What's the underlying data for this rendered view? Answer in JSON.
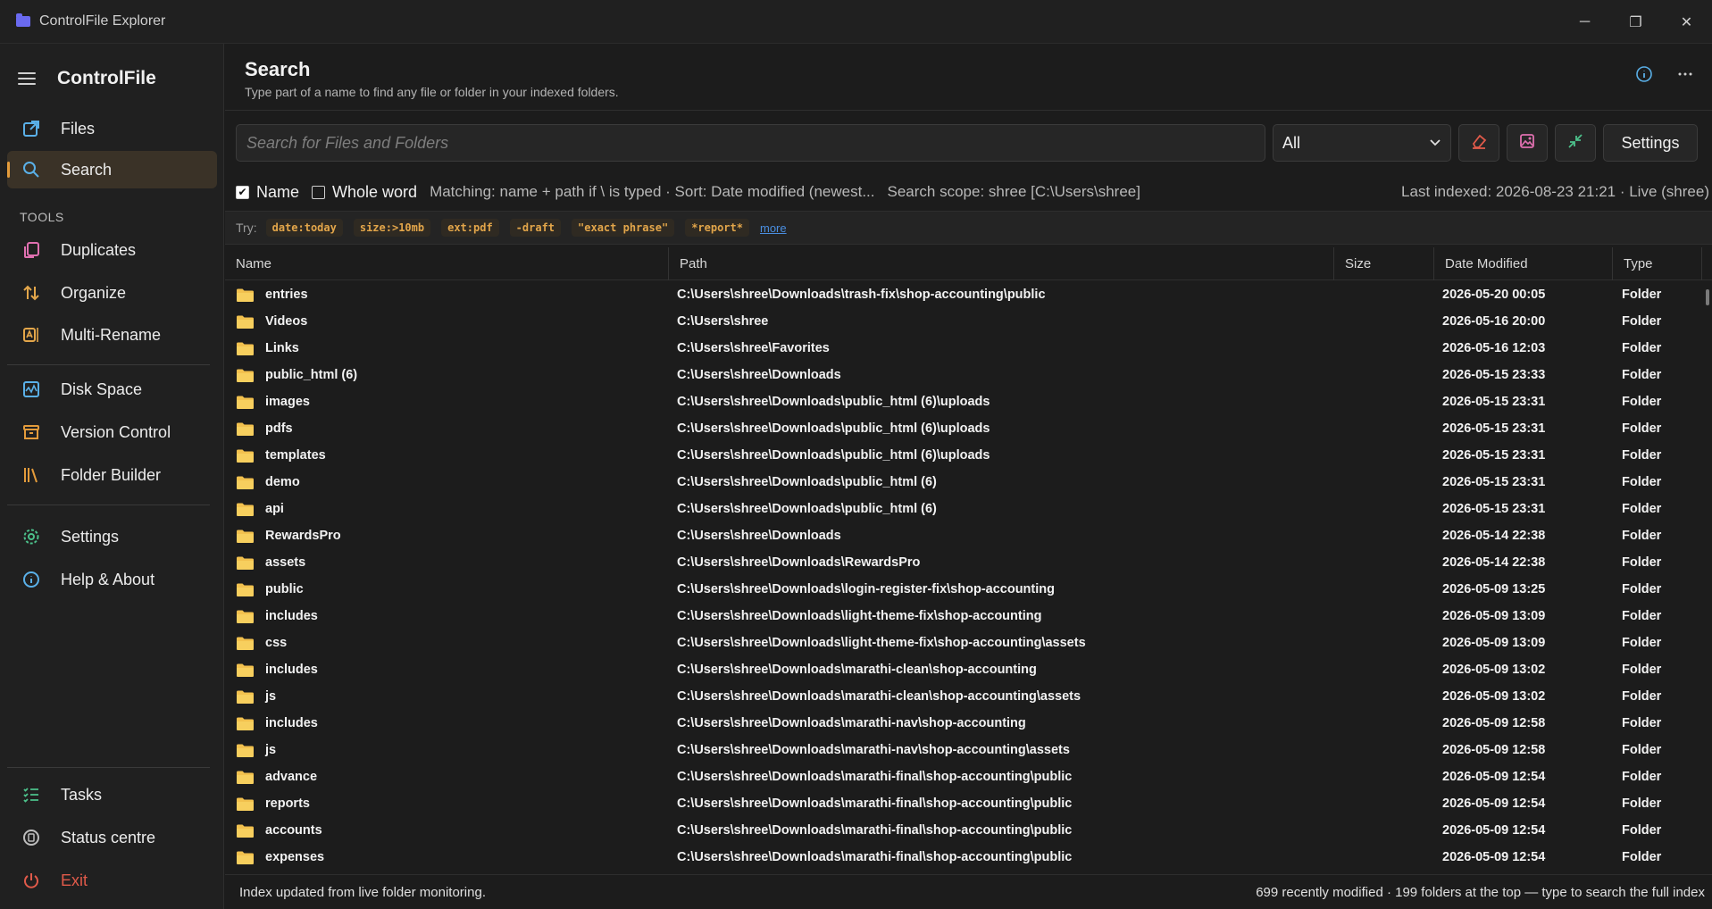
{
  "window": {
    "title": "ControlFile Explorer",
    "controls": {
      "minimize": "─",
      "restore": "❐",
      "close": "✕"
    }
  },
  "sidebar": {
    "brand": "ControlFile",
    "tools_label": "TOOLS",
    "items": [
      {
        "label": "Files",
        "icon": "external-link-icon",
        "color": "#5ab0e8"
      },
      {
        "label": "Search",
        "icon": "search-icon",
        "color": "#5ab0e8",
        "active": true
      },
      {
        "label": "Duplicates",
        "icon": "copy-icon",
        "color": "#e070b0"
      },
      {
        "label": "Organize",
        "icon": "sort-arrows-icon",
        "color": "#e3a64a"
      },
      {
        "label": "Multi-Rename",
        "icon": "rename-icon",
        "color": "#e3a64a"
      },
      {
        "label": "Disk Space",
        "icon": "activity-icon",
        "color": "#5ab0e8"
      },
      {
        "label": "Version Control",
        "icon": "archive-icon",
        "color": "#e39b3b"
      },
      {
        "label": "Folder Builder",
        "icon": "library-icon",
        "color": "#e39b3b"
      },
      {
        "label": "Settings",
        "icon": "gear-icon",
        "color": "#4cc08a"
      },
      {
        "label": "Help & About",
        "icon": "info-icon",
        "color": "#5ab0e8"
      },
      {
        "label": "Tasks",
        "icon": "checklist-icon",
        "color": "#4cc08a"
      },
      {
        "label": "Status centre",
        "icon": "status-icon",
        "color": "#bdbdbd"
      },
      {
        "label": "Exit",
        "icon": "power-icon",
        "color": "#e05a4a"
      }
    ]
  },
  "header": {
    "title": "Search",
    "subtitle": "Type part of a name to find any file or folder in your indexed folders."
  },
  "toolbar": {
    "search_placeholder": "Search for Files and Folders",
    "search_value": "",
    "filter_selected": "All",
    "settings_label": "Settings"
  },
  "options": {
    "name_label": "Name",
    "name_checked": true,
    "whole_word_label": "Whole word",
    "whole_word_checked": false,
    "matching_info": "Matching: name + path if \\ is typed · Sort: Date modified (newest...",
    "scope_info": "Search scope: shree  [C:\\Users\\shree]",
    "last_indexed": "Last indexed: 2026-08-23 21:21 · Live (shree)"
  },
  "try_row": {
    "label": "Try:",
    "chips": [
      "date:today",
      "size:>10mb",
      "ext:pdf",
      "-draft",
      "\"exact phrase\"",
      "*report*"
    ],
    "more": "more"
  },
  "table": {
    "columns": [
      "Name",
      "Path",
      "Size",
      "Date Modified",
      "Type"
    ],
    "rows": [
      {
        "name": "entries",
        "path": "C:\\Users\\shree\\Downloads\\trash-fix\\shop-accounting\\public",
        "size": "",
        "date": "2026-05-20 00:05",
        "type": "Folder"
      },
      {
        "name": "Videos",
        "path": "C:\\Users\\shree",
        "size": "",
        "date": "2026-05-16 20:00",
        "type": "Folder"
      },
      {
        "name": "Links",
        "path": "C:\\Users\\shree\\Favorites",
        "size": "",
        "date": "2026-05-16 12:03",
        "type": "Folder"
      },
      {
        "name": "public_html (6)",
        "path": "C:\\Users\\shree\\Downloads",
        "size": "",
        "date": "2026-05-15 23:33",
        "type": "Folder"
      },
      {
        "name": "images",
        "path": "C:\\Users\\shree\\Downloads\\public_html (6)\\uploads",
        "size": "",
        "date": "2026-05-15 23:31",
        "type": "Folder"
      },
      {
        "name": "pdfs",
        "path": "C:\\Users\\shree\\Downloads\\public_html (6)\\uploads",
        "size": "",
        "date": "2026-05-15 23:31",
        "type": "Folder"
      },
      {
        "name": "templates",
        "path": "C:\\Users\\shree\\Downloads\\public_html (6)\\uploads",
        "size": "",
        "date": "2026-05-15 23:31",
        "type": "Folder"
      },
      {
        "name": "demo",
        "path": "C:\\Users\\shree\\Downloads\\public_html (6)",
        "size": "",
        "date": "2026-05-15 23:31",
        "type": "Folder"
      },
      {
        "name": "api",
        "path": "C:\\Users\\shree\\Downloads\\public_html (6)",
        "size": "",
        "date": "2026-05-15 23:31",
        "type": "Folder"
      },
      {
        "name": "RewardsPro",
        "path": "C:\\Users\\shree\\Downloads",
        "size": "",
        "date": "2026-05-14 22:38",
        "type": "Folder"
      },
      {
        "name": "assets",
        "path": "C:\\Users\\shree\\Downloads\\RewardsPro",
        "size": "",
        "date": "2026-05-14 22:38",
        "type": "Folder"
      },
      {
        "name": "public",
        "path": "C:\\Users\\shree\\Downloads\\login-register-fix\\shop-accounting",
        "size": "",
        "date": "2026-05-09 13:25",
        "type": "Folder"
      },
      {
        "name": "includes",
        "path": "C:\\Users\\shree\\Downloads\\light-theme-fix\\shop-accounting",
        "size": "",
        "date": "2026-05-09 13:09",
        "type": "Folder"
      },
      {
        "name": "css",
        "path": "C:\\Users\\shree\\Downloads\\light-theme-fix\\shop-accounting\\assets",
        "size": "",
        "date": "2026-05-09 13:09",
        "type": "Folder"
      },
      {
        "name": "includes",
        "path": "C:\\Users\\shree\\Downloads\\marathi-clean\\shop-accounting",
        "size": "",
        "date": "2026-05-09 13:02",
        "type": "Folder"
      },
      {
        "name": "js",
        "path": "C:\\Users\\shree\\Downloads\\marathi-clean\\shop-accounting\\assets",
        "size": "",
        "date": "2026-05-09 13:02",
        "type": "Folder"
      },
      {
        "name": "includes",
        "path": "C:\\Users\\shree\\Downloads\\marathi-nav\\shop-accounting",
        "size": "",
        "date": "2026-05-09 12:58",
        "type": "Folder"
      },
      {
        "name": "js",
        "path": "C:\\Users\\shree\\Downloads\\marathi-nav\\shop-accounting\\assets",
        "size": "",
        "date": "2026-05-09 12:58",
        "type": "Folder"
      },
      {
        "name": "advance",
        "path": "C:\\Users\\shree\\Downloads\\marathi-final\\shop-accounting\\public",
        "size": "",
        "date": "2026-05-09 12:54",
        "type": "Folder"
      },
      {
        "name": "reports",
        "path": "C:\\Users\\shree\\Downloads\\marathi-final\\shop-accounting\\public",
        "size": "",
        "date": "2026-05-09 12:54",
        "type": "Folder"
      },
      {
        "name": "accounts",
        "path": "C:\\Users\\shree\\Downloads\\marathi-final\\shop-accounting\\public",
        "size": "",
        "date": "2026-05-09 12:54",
        "type": "Folder"
      },
      {
        "name": "expenses",
        "path": "C:\\Users\\shree\\Downloads\\marathi-final\\shop-accounting\\public",
        "size": "",
        "date": "2026-05-09 12:54",
        "type": "Folder"
      }
    ]
  },
  "status": {
    "left": "Index updated from live folder monitoring.",
    "right": "699 recently modified · 199 folders at the top — type to search the full index"
  },
  "colors": {
    "accent": "#e39b3b",
    "folder": "#f2c14e",
    "link": "#4a8ee0",
    "chip_text": "#e3a64a"
  }
}
